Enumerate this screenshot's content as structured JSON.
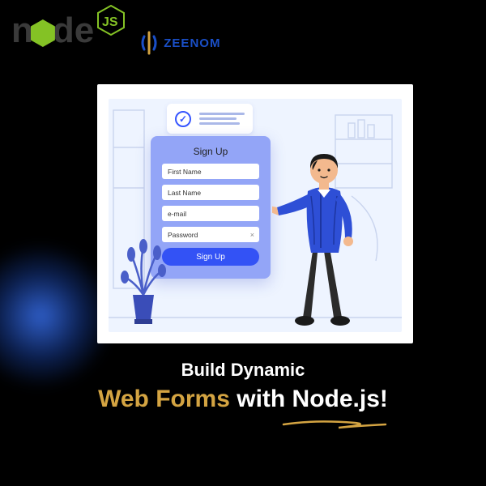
{
  "logos": {
    "node_name": "node",
    "zeenom_name": "ZEENOM"
  },
  "form": {
    "title": "Sign Up",
    "fields": {
      "first_name": "First Name",
      "last_name": "Last Name",
      "email": "e-mail",
      "password": "Password"
    },
    "submit_label": "Sign Up"
  },
  "caption": {
    "line1": "Build Dynamic",
    "line2_gold": "Web Forms",
    "line2_white": " with Node.js!"
  }
}
